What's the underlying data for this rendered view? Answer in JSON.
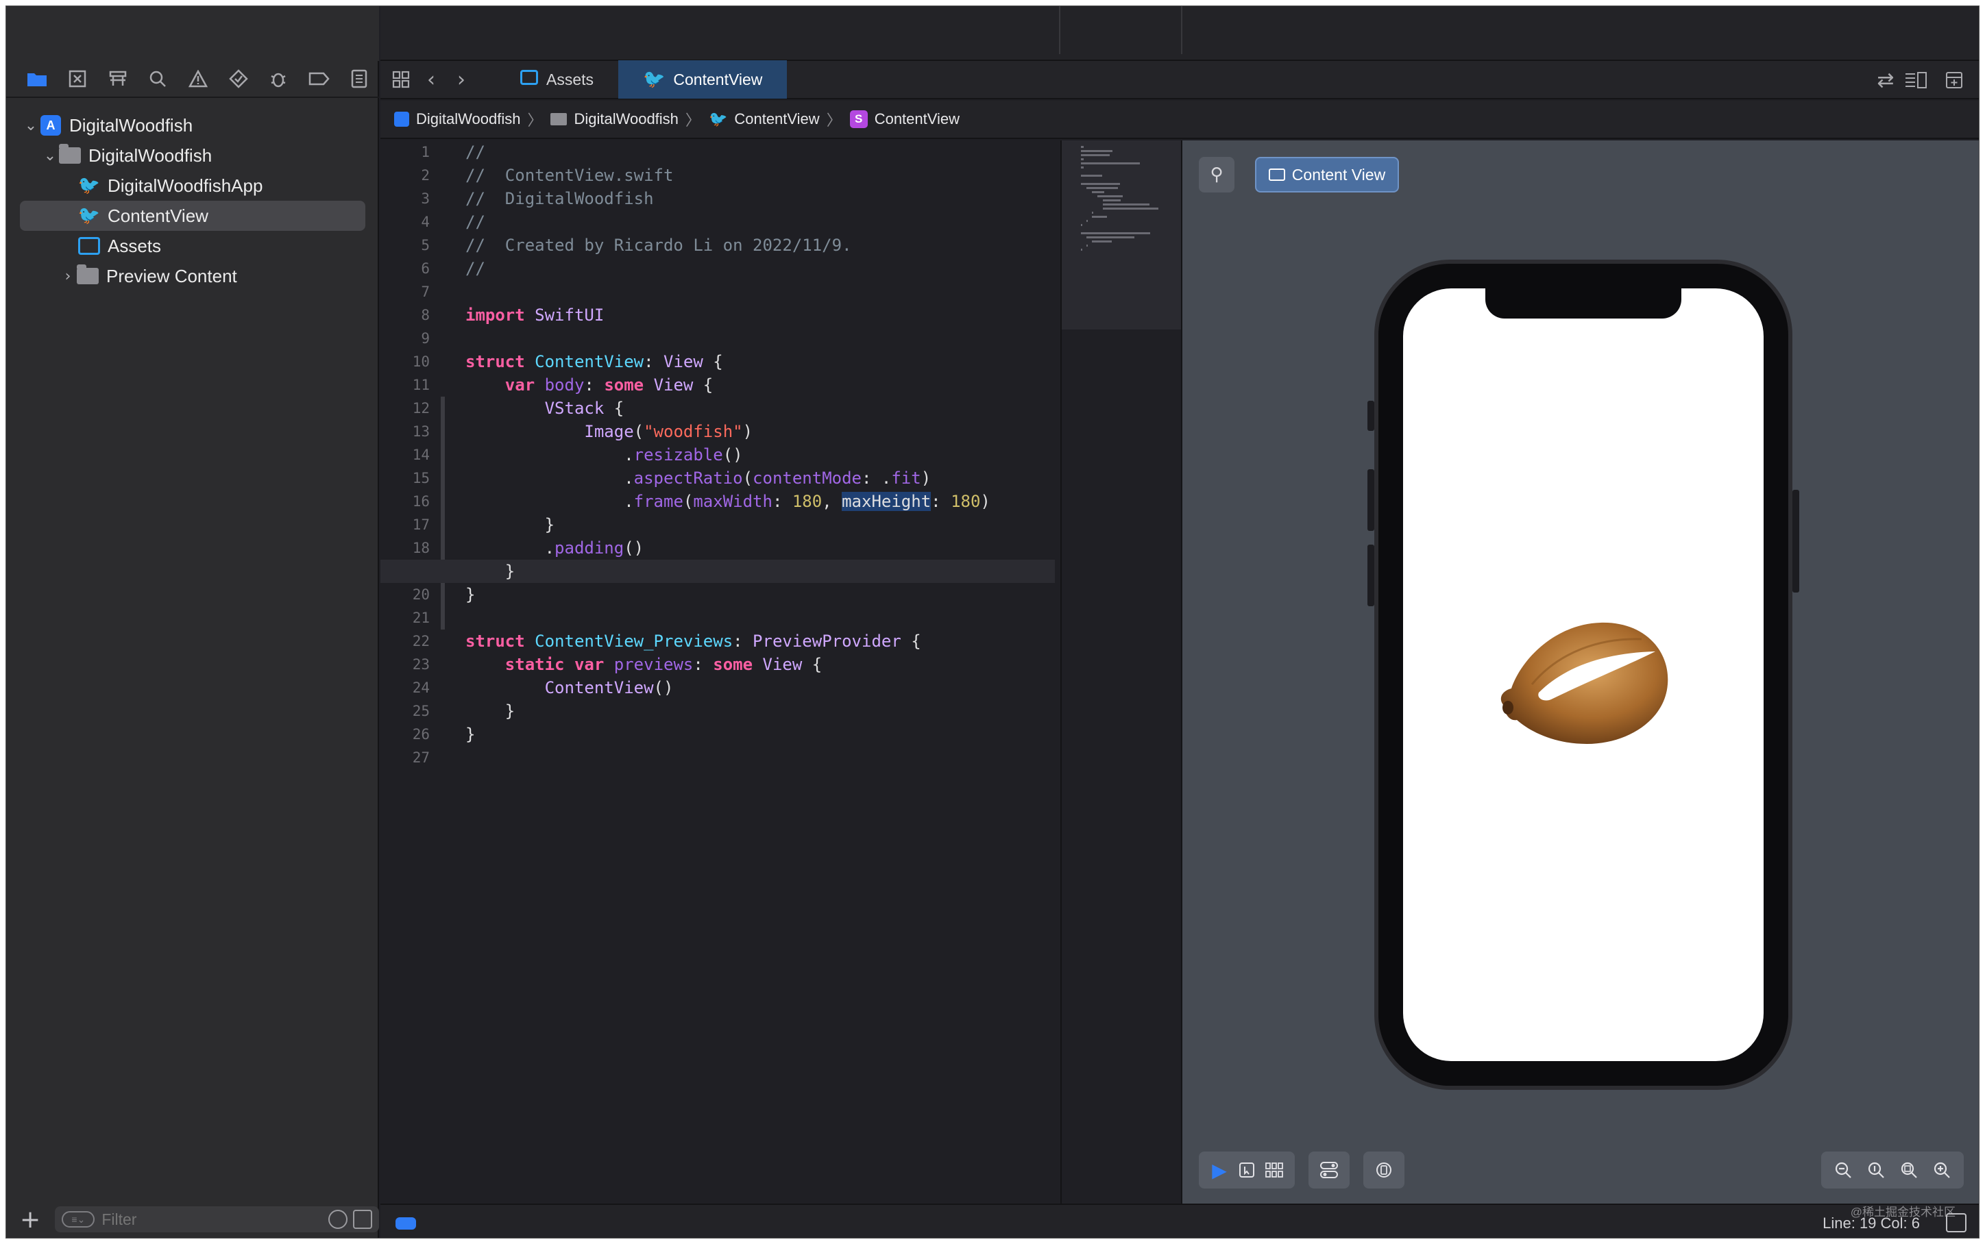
{
  "navigator": {
    "icons": [
      "folder-icon",
      "source-control-icon",
      "symbols-icon",
      "find-icon",
      "issue-icon",
      "test-icon",
      "debug-icon",
      "breakpoint-icon",
      "report-icon"
    ],
    "tree": [
      {
        "label": "DigitalWoodfish",
        "kind": "project",
        "indent": 0,
        "expanded": true
      },
      {
        "label": "DigitalWoodfish",
        "kind": "folder",
        "indent": 1,
        "expanded": true
      },
      {
        "label": "DigitalWoodfishApp",
        "kind": "swift",
        "indent": 2
      },
      {
        "label": "ContentView",
        "kind": "swift",
        "indent": 2,
        "selected": true
      },
      {
        "label": "Assets",
        "kind": "assets",
        "indent": 2
      },
      {
        "label": "Preview Content",
        "kind": "folder",
        "indent": 2,
        "expanded": false
      }
    ],
    "filter_placeholder": "Filter"
  },
  "tabs": [
    {
      "label": "Assets",
      "active": false
    },
    {
      "label": "ContentView",
      "active": true
    }
  ],
  "jumpbar": [
    "DigitalWoodfish",
    "DigitalWoodfish",
    "ContentView",
    "ContentView"
  ],
  "editor": {
    "current_line": 19,
    "lines": [
      "//",
      "//  ContentView.swift",
      "//  DigitalWoodfish",
      "//",
      "//  Created by Ricardo Li on 2022/11/9.",
      "//",
      "",
      "import SwiftUI",
      "",
      "struct ContentView: View {",
      "    var body: some View {",
      "        VStack {",
      "            Image(\"woodfish\")",
      "                .resizable()",
      "                .aspectRatio(contentMode: .fit)",
      "                .frame(maxWidth: 180, maxHeight: 180)",
      "        }",
      "        .padding()",
      "    }",
      "}",
      "",
      "struct ContentView_Previews: PreviewProvider {",
      "    static var previews: some View {",
      "        ContentView()",
      "    }",
      "}",
      ""
    ]
  },
  "preview": {
    "content_view_label": "Content View",
    "image_name": "woodfish"
  },
  "statusbar": {
    "line_col": "Line: 19  Col: 6",
    "watermark": "@稀土掘金技术社区"
  },
  "colors": {
    "accent": "#2f7cf6",
    "keyword": "#fc5fa3",
    "type": "#5dd8ff",
    "string": "#fc6a5d",
    "number": "#d0bf69",
    "comment": "#7f8c98"
  }
}
